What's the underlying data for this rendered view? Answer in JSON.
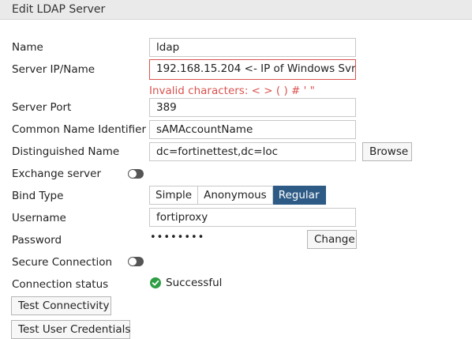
{
  "header": {
    "title": "Edit LDAP Server"
  },
  "fields": {
    "name": {
      "label": "Name",
      "value": "ldap"
    },
    "server_ip": {
      "label": "Server IP/Name",
      "value": "192.168.15.204 <- IP of Windows Svr",
      "error": "Invalid characters: < > ( ) # ' \""
    },
    "server_port": {
      "label": "Server Port",
      "value": "389"
    },
    "cn_identifier": {
      "label": "Common Name Identifier",
      "value": "sAMAccountName"
    },
    "dn": {
      "label": "Distinguished Name",
      "value": "dc=fortinettest,dc=loc",
      "browse_label": "Browse"
    },
    "exchange": {
      "label": "Exchange server",
      "enabled": false
    },
    "bind_type": {
      "label": "Bind Type",
      "options": [
        "Simple",
        "Anonymous",
        "Regular"
      ],
      "selected": "Regular"
    },
    "username": {
      "label": "Username",
      "value": "fortiproxy"
    },
    "password": {
      "label": "Password",
      "value": "••••••••",
      "change_label": "Change"
    },
    "secure": {
      "label": "Secure Connection",
      "enabled": false
    },
    "connection_status": {
      "label": "Connection status",
      "value": "Successful",
      "icon": "check-circle-icon",
      "color": "#2e9e44"
    }
  },
  "buttons": {
    "test_connectivity": "Test Connectivity",
    "test_user_credentials": "Test User Credentials"
  },
  "colors": {
    "accent": "#2d5b86",
    "error": "#d9534f",
    "success": "#2e9e44"
  }
}
